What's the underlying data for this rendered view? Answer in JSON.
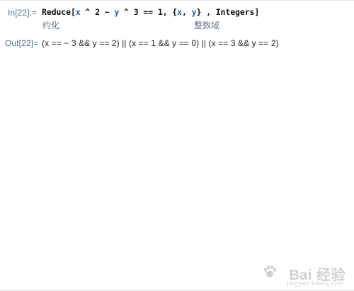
{
  "notebook": {
    "input_label": "In[22]:=",
    "input_tokens": {
      "reduce": "Reduce",
      "open_bracket": "[",
      "x1": "x",
      "caret1": " ^ 2 ",
      "minus": "−",
      "y1": " y",
      "caret2": " ^ 3 ",
      "equal": "==",
      "one": " 1, {",
      "x2": "x",
      "comma": ", ",
      "y2": "y",
      "close_brace": "}",
      "integers": " , Integers]"
    },
    "hints": {
      "reduce": "约化",
      "integers": "整数域"
    },
    "output_label": "Out[22]=",
    "output_text": "(x == − 3 && y == 2) || (x == 1 && y == 0) || (x == 3 && y == 2)"
  },
  "watermark": {
    "logo_text": "Bai 经验",
    "url": "jingyan.baidu.com",
    "color": "#9a9a9a"
  },
  "colors": {
    "label": "#4a6f97",
    "variable": "#2f5aa8",
    "hint": "#66768a",
    "text": "#111111"
  }
}
